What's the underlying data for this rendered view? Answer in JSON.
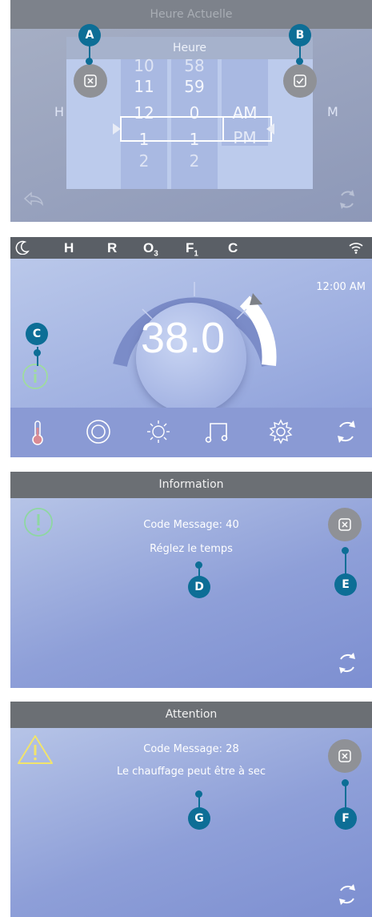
{
  "callouts": {
    "a": "A",
    "b": "B",
    "c": "C",
    "d": "D",
    "e": "E",
    "f": "F",
    "g": "G"
  },
  "panel1": {
    "header": "Heure Actuelle",
    "dialog_title": "Heure",
    "hours": [
      "10",
      "11",
      "12",
      "1",
      "2"
    ],
    "minutes": [
      "58",
      "59",
      "0",
      "1",
      "2"
    ],
    "ampm": [
      "AM",
      "PM"
    ],
    "behind_left": "H",
    "behind_right": "M",
    "cancel_icon": "close-x-icon",
    "confirm_icon": "check-icon"
  },
  "panel2": {
    "status_icons": {
      "moon": "moon-icon",
      "h": "H",
      "r": "R",
      "o3": "O",
      "o3_sub": "3",
      "f1": "F",
      "f1_sub": "1",
      "c": "C",
      "wifi": "wifi-icon"
    },
    "time": "12:00 AM",
    "temperature": "38.0",
    "bottom_icons": [
      "thermometer-icon",
      "circle-mode-icon",
      "light-icon",
      "music-icon",
      "gear-icon",
      "refresh-icon"
    ]
  },
  "panel3": {
    "header": "Information",
    "line1": "Code Message: 40",
    "line2": "Réglez le temps"
  },
  "panel4": {
    "header": "Attention",
    "line1": "Code Message: 28",
    "line2": "Le chauffage peut être à sec"
  },
  "colors": {
    "callout": "#0d6e96",
    "info_green": "#8ed7a1",
    "warning_yellow": "#f1e46c"
  }
}
